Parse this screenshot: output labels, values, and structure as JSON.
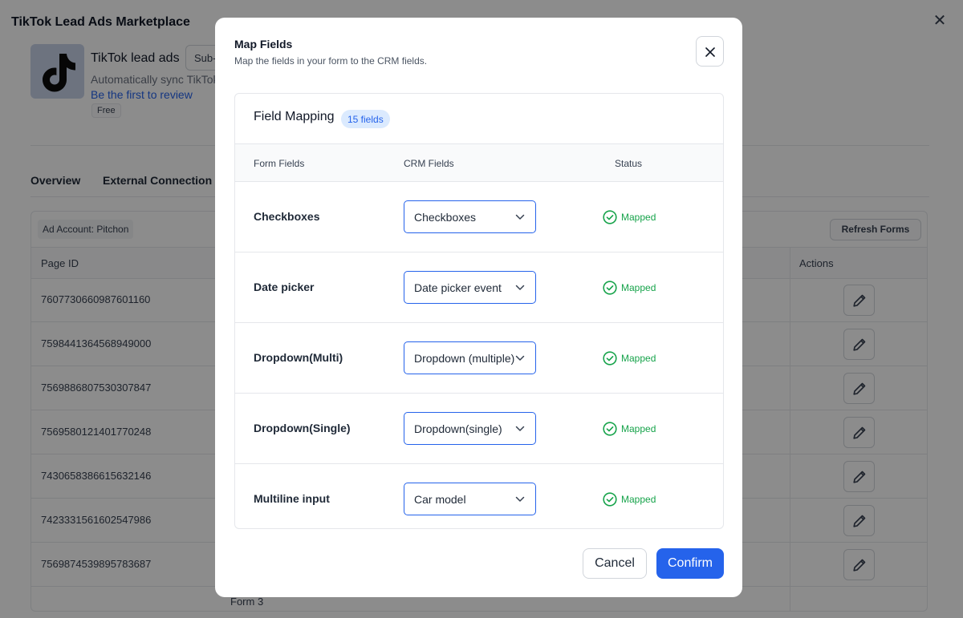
{
  "background": {
    "title": "TikTok Lead Ads Marketplace",
    "app": {
      "name": "TikTok lead ads",
      "chip_label": "Sub-",
      "description": "Automatically sync TikTok",
      "review_link": "Be the first to review",
      "price_badge": "Free"
    },
    "tabs": [
      "Overview",
      "External Connection"
    ],
    "ad_account": "Ad Account: Pitchon",
    "refresh_button": "Refresh Forms",
    "table": {
      "headers": {
        "page_id": "Page ID",
        "actions": "Actions"
      },
      "rows": [
        "7607730660987601160",
        "7598441364568949000",
        "7569886807530307847",
        "7569580121401770248",
        "7430658386615632146",
        "7423331561602547986",
        "7569874539895783687"
      ],
      "partial_row_text": "Form 3"
    }
  },
  "modal": {
    "title": "Map Fields",
    "subtitle": "Map the fields in your form to the CRM fields.",
    "card": {
      "title": "Field Mapping",
      "badge": "15 fields",
      "columns": {
        "form": "Form Fields",
        "crm": "CRM Fields",
        "status": "Status"
      },
      "rows": [
        {
          "form_field": "Checkboxes",
          "crm_field": "Checkboxes",
          "status": "Mapped"
        },
        {
          "form_field": "Date picker",
          "crm_field": "Date picker event",
          "status": "Mapped"
        },
        {
          "form_field": "Dropdown(Multi)",
          "crm_field": "Dropdown (multiple)",
          "status": "Mapped"
        },
        {
          "form_field": "Dropdown(Single)",
          "crm_field": "Dropdown(single)",
          "status": "Mapped"
        },
        {
          "form_field": "Multiline input",
          "crm_field": "Car model",
          "status": "Mapped"
        }
      ]
    },
    "cancel_label": "Cancel",
    "confirm_label": "Confirm"
  },
  "colors": {
    "primary": "#2563eb",
    "success": "#16a34a",
    "overlay": "rgba(0,0,0,0.45)"
  },
  "icons": [
    "tiktok-logo-icon",
    "close-icon",
    "edit-pencil-icon",
    "chevron-down-icon",
    "check-circle-icon"
  ]
}
